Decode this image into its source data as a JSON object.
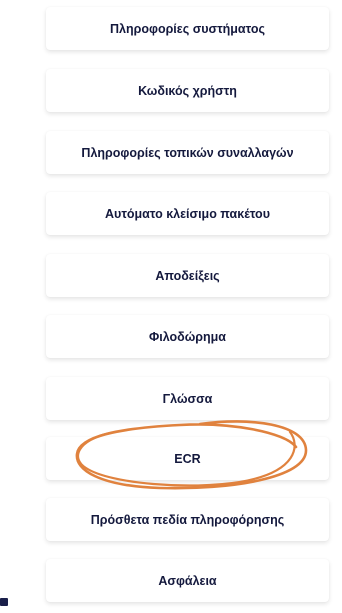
{
  "menu": {
    "items": [
      {
        "label": "Πληροφορίες συστήματος"
      },
      {
        "label": "Κωδικός χρήστη"
      },
      {
        "label": "Πληροφορίες τοπικών συναλλαγών"
      },
      {
        "label": "Αυτόματο κλείσιμο πακέτου"
      },
      {
        "label": "Αποδείξεις"
      },
      {
        "label": "Φιλοδώρημα"
      },
      {
        "label": "Γλώσσα"
      },
      {
        "label": "ECR"
      },
      {
        "label": "Πρόσθετα πεδία πληροφόρησης"
      },
      {
        "label": "Ασφάλεια"
      }
    ]
  },
  "annotation": {
    "color": "#e0823e",
    "highlights_item": "ECR"
  }
}
